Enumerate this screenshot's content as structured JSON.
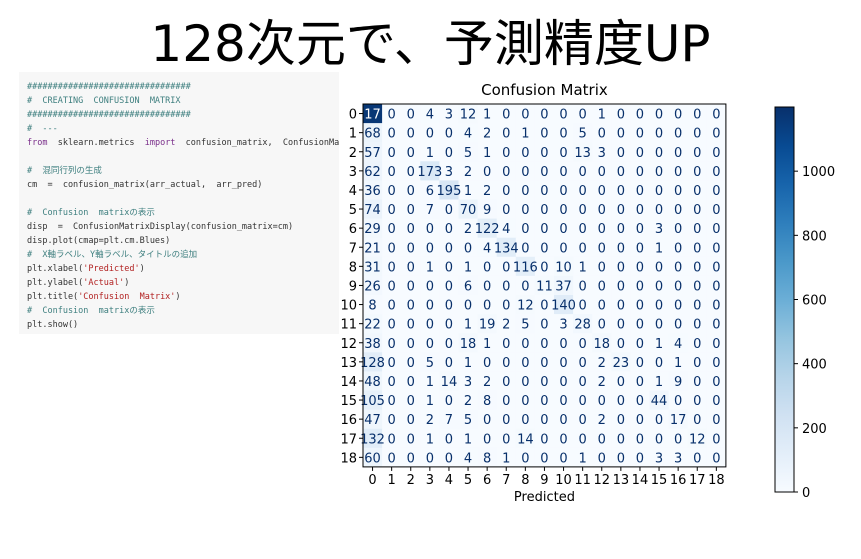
{
  "slide_title": "128次元で、予測精度UP",
  "code_lines": [
    {
      "text": "################################",
      "style": "cm"
    },
    {
      "text": "#  CREATING  CONFUSION  MATRIX",
      "style": "cm"
    },
    {
      "text": "################################",
      "style": "cm"
    },
    {
      "text": "#  ---",
      "style": "cm"
    },
    {
      "text": "from  sklearn.metrics  import  confusion_matrix,  ConfusionMa",
      "style": "code"
    },
    {
      "text": "",
      "style": "code"
    },
    {
      "text": "#  混同行列の生成",
      "style": "cm"
    },
    {
      "text": "cm  =  confusion_matrix(arr_actual,  arr_pred)",
      "style": "code"
    },
    {
      "text": "",
      "style": "code"
    },
    {
      "text": "#  Confusion  matrixの表示",
      "style": "cm"
    },
    {
      "text": "disp  =  ConfusionMatrixDisplay(confusion_matrix=cm)",
      "style": "code"
    },
    {
      "text": "disp.plot(cmap=plt.cm.Blues)",
      "style": "code"
    },
    {
      "text": "#  X軸ラベル、Y軸ラベル、タイトルの追加",
      "style": "cm"
    },
    {
      "text": "plt.xlabel('Predicted')",
      "style": "code"
    },
    {
      "text": "plt.ylabel('Actual')",
      "style": "code"
    },
    {
      "text": "plt.title('Confusion  Matrix')",
      "style": "code"
    },
    {
      "text": "#  Confusion  matrixの表示",
      "style": "cm"
    },
    {
      "text": "plt.show()",
      "style": "code"
    }
  ],
  "chart_data": {
    "type": "heatmap",
    "title": "Confusion Matrix",
    "xlabel": "Predicted",
    "ylabel": "",
    "x_ticks": [
      "0",
      "1",
      "2",
      "3",
      "4",
      "5",
      "6",
      "7",
      "8",
      "9",
      "10",
      "11",
      "12",
      "13",
      "14",
      "15",
      "16",
      "17",
      "18"
    ],
    "y_ticks": [
      "0",
      "1",
      "2",
      "3",
      "4",
      "5",
      "6",
      "7",
      "8",
      "9",
      "10",
      "11",
      "12",
      "13",
      "14",
      "15",
      "16",
      "17",
      "18"
    ],
    "cell_labels": [
      [
        "17",
        "0",
        "0",
        "4",
        "3",
        "12",
        "1",
        "0",
        "0",
        "0",
        "0",
        "0",
        "1",
        "0",
        "0",
        "0",
        "0",
        "0",
        "0"
      ],
      [
        "68",
        "0",
        "0",
        "0",
        "0",
        "4",
        "2",
        "0",
        "1",
        "0",
        "0",
        "5",
        "0",
        "0",
        "0",
        "0",
        "0",
        "0",
        "0"
      ],
      [
        "57",
        "0",
        "0",
        "1",
        "0",
        "5",
        "1",
        "0",
        "0",
        "0",
        "0",
        "13",
        "3",
        "0",
        "0",
        "0",
        "0",
        "0",
        "0"
      ],
      [
        "62",
        "0",
        "0",
        "173",
        "3",
        "2",
        "0",
        "0",
        "0",
        "0",
        "0",
        "0",
        "0",
        "0",
        "0",
        "0",
        "0",
        "0",
        "0"
      ],
      [
        "36",
        "0",
        "0",
        "6",
        "195",
        "1",
        "2",
        "0",
        "0",
        "0",
        "0",
        "0",
        "0",
        "0",
        "0",
        "0",
        "0",
        "0",
        "0"
      ],
      [
        "74",
        "0",
        "0",
        "7",
        "0",
        "70",
        "9",
        "0",
        "0",
        "0",
        "0",
        "0",
        "0",
        "0",
        "0",
        "0",
        "0",
        "0",
        "0"
      ],
      [
        "29",
        "0",
        "0",
        "0",
        "0",
        "2",
        "122",
        "4",
        "0",
        "0",
        "0",
        "0",
        "0",
        "0",
        "0",
        "3",
        "0",
        "0",
        "0"
      ],
      [
        "21",
        "0",
        "0",
        "0",
        "0",
        "0",
        "4",
        "134",
        "0",
        "0",
        "0",
        "0",
        "0",
        "0",
        "0",
        "1",
        "0",
        "0",
        "0"
      ],
      [
        "31",
        "0",
        "0",
        "1",
        "0",
        "1",
        "0",
        "0",
        "116",
        "0",
        "10",
        "1",
        "0",
        "0",
        "0",
        "0",
        "0",
        "0",
        "0"
      ],
      [
        "26",
        "0",
        "0",
        "0",
        "0",
        "6",
        "0",
        "0",
        "0",
        "11",
        "37",
        "0",
        "0",
        "0",
        "0",
        "0",
        "0",
        "0",
        "0"
      ],
      [
        "8",
        "0",
        "0",
        "0",
        "0",
        "0",
        "0",
        "0",
        "12",
        "0",
        "140",
        "0",
        "0",
        "0",
        "0",
        "0",
        "0",
        "0",
        "0"
      ],
      [
        "22",
        "0",
        "0",
        "0",
        "0",
        "1",
        "19",
        "2",
        "5",
        "0",
        "3",
        "28",
        "0",
        "0",
        "0",
        "0",
        "0",
        "0",
        "0"
      ],
      [
        "38",
        "0",
        "0",
        "0",
        "0",
        "18",
        "1",
        "0",
        "0",
        "0",
        "0",
        "0",
        "18",
        "0",
        "0",
        "1",
        "4",
        "0",
        "0"
      ],
      [
        "128",
        "0",
        "0",
        "5",
        "0",
        "1",
        "0",
        "0",
        "0",
        "0",
        "0",
        "0",
        "2",
        "23",
        "0",
        "0",
        "1",
        "0",
        "0"
      ],
      [
        "48",
        "0",
        "0",
        "1",
        "14",
        "3",
        "2",
        "0",
        "0",
        "0",
        "0",
        "0",
        "2",
        "0",
        "0",
        "1",
        "9",
        "0",
        "0"
      ],
      [
        "105",
        "0",
        "0",
        "1",
        "0",
        "2",
        "8",
        "0",
        "0",
        "0",
        "0",
        "0",
        "0",
        "0",
        "0",
        "44",
        "0",
        "0",
        "0"
      ],
      [
        "47",
        "0",
        "0",
        "2",
        "7",
        "5",
        "0",
        "0",
        "0",
        "0",
        "0",
        "0",
        "2",
        "0",
        "0",
        "0",
        "17",
        "0",
        "0"
      ],
      [
        "132",
        "0",
        "0",
        "1",
        "0",
        "1",
        "0",
        "0",
        "14",
        "0",
        "0",
        "0",
        "0",
        "0",
        "0",
        "0",
        "0",
        "12",
        "0"
      ],
      [
        "60",
        "0",
        "0",
        "0",
        "0",
        "4",
        "8",
        "1",
        "0",
        "0",
        "0",
        "1",
        "0",
        "0",
        "0",
        "3",
        "3",
        "0",
        "0"
      ]
    ],
    "cell_values": [
      [
        1170,
        0,
        0,
        4,
        3,
        12,
        1,
        0,
        0,
        0,
        0,
        0,
        1,
        0,
        0,
        0,
        0,
        0,
        0
      ],
      [
        68,
        0,
        0,
        0,
        0,
        4,
        2,
        0,
        1,
        0,
        0,
        5,
        0,
        0,
        0,
        0,
        0,
        0,
        0
      ],
      [
        57,
        0,
        0,
        1,
        0,
        5,
        1,
        0,
        0,
        0,
        0,
        13,
        3,
        0,
        0,
        0,
        0,
        0,
        0
      ],
      [
        62,
        0,
        0,
        173,
        3,
        2,
        0,
        0,
        0,
        0,
        0,
        0,
        0,
        0,
        0,
        0,
        0,
        0,
        0
      ],
      [
        36,
        0,
        0,
        6,
        195,
        1,
        2,
        0,
        0,
        0,
        0,
        0,
        0,
        0,
        0,
        0,
        0,
        0,
        0
      ],
      [
        74,
        0,
        0,
        7,
        0,
        70,
        9,
        0,
        0,
        0,
        0,
        0,
        0,
        0,
        0,
        0,
        0,
        0,
        0
      ],
      [
        29,
        0,
        0,
        0,
        0,
        2,
        122,
        4,
        0,
        0,
        0,
        0,
        0,
        0,
        0,
        3,
        0,
        0,
        0
      ],
      [
        21,
        0,
        0,
        0,
        0,
        0,
        4,
        134,
        0,
        0,
        0,
        0,
        0,
        0,
        0,
        1,
        0,
        0,
        0
      ],
      [
        31,
        0,
        0,
        1,
        0,
        1,
        0,
        0,
        116,
        0,
        10,
        1,
        0,
        0,
        0,
        0,
        0,
        0,
        0
      ],
      [
        26,
        0,
        0,
        0,
        0,
        6,
        0,
        0,
        0,
        11,
        37,
        0,
        0,
        0,
        0,
        0,
        0,
        0,
        0
      ],
      [
        8,
        0,
        0,
        0,
        0,
        0,
        0,
        0,
        12,
        0,
        140,
        0,
        0,
        0,
        0,
        0,
        0,
        0,
        0
      ],
      [
        22,
        0,
        0,
        0,
        0,
        1,
        19,
        2,
        5,
        0,
        3,
        28,
        0,
        0,
        0,
        0,
        0,
        0,
        0
      ],
      [
        38,
        0,
        0,
        0,
        0,
        18,
        1,
        0,
        0,
        0,
        0,
        0,
        18,
        0,
        0,
        1,
        4,
        0,
        0
      ],
      [
        128,
        0,
        0,
        5,
        0,
        1,
        0,
        0,
        0,
        0,
        0,
        0,
        2,
        23,
        0,
        0,
        1,
        0,
        0
      ],
      [
        48,
        0,
        0,
        1,
        14,
        3,
        2,
        0,
        0,
        0,
        0,
        0,
        2,
        0,
        0,
        1,
        9,
        0,
        0
      ],
      [
        105,
        0,
        0,
        1,
        0,
        2,
        8,
        0,
        0,
        0,
        0,
        0,
        0,
        0,
        0,
        44,
        0,
        0,
        0
      ],
      [
        47,
        0,
        0,
        2,
        7,
        5,
        0,
        0,
        0,
        0,
        0,
        0,
        2,
        0,
        0,
        0,
        17,
        0,
        0
      ],
      [
        132,
        0,
        0,
        1,
        0,
        1,
        0,
        0,
        14,
        0,
        0,
        0,
        0,
        0,
        0,
        0,
        0,
        12,
        0
      ],
      [
        60,
        0,
        0,
        0,
        0,
        4,
        8,
        1,
        0,
        0,
        0,
        1,
        0,
        0,
        0,
        3,
        3,
        0,
        0
      ]
    ],
    "value_range": [
      0,
      1200
    ],
    "colorbar_ticks": [
      0,
      200,
      400,
      600,
      800,
      1000
    ],
    "colormap": "Blues",
    "color_low": "#f7fbff",
    "color_high": "#08306b",
    "dark_text_threshold": 600
  }
}
